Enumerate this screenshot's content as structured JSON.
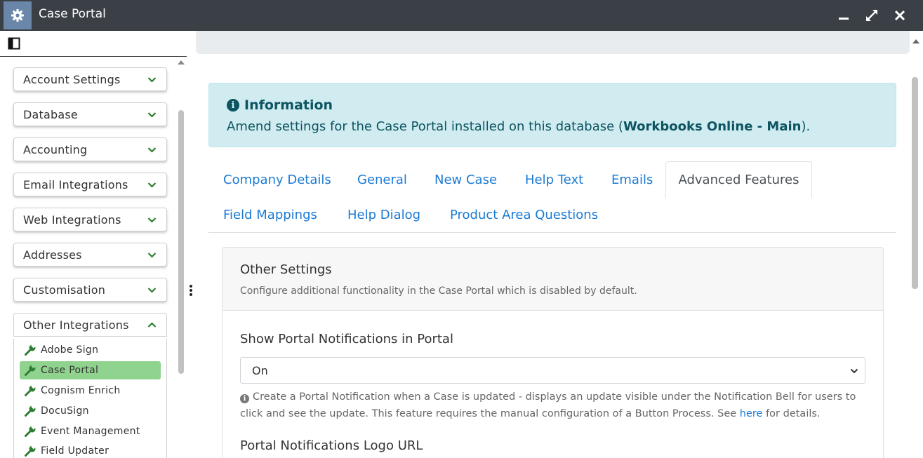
{
  "window": {
    "title": "Case Portal"
  },
  "sidebar": {
    "menus": [
      {
        "label": "Account Settings",
        "expanded": false
      },
      {
        "label": "Database",
        "expanded": false
      },
      {
        "label": "Accounting",
        "expanded": false
      },
      {
        "label": "Email Integrations",
        "expanded": false
      },
      {
        "label": "Web Integrations",
        "expanded": false
      },
      {
        "label": "Addresses",
        "expanded": false
      },
      {
        "label": "Customisation",
        "expanded": false
      },
      {
        "label": "Other Integrations",
        "expanded": true
      }
    ],
    "sub_items": [
      {
        "label": "Adobe Sign",
        "active": false
      },
      {
        "label": "Case Portal",
        "active": true
      },
      {
        "label": "Cognism Enrich",
        "active": false
      },
      {
        "label": "DocuSign",
        "active": false
      },
      {
        "label": "Event Management",
        "active": false
      },
      {
        "label": "Field Updater",
        "active": false
      }
    ]
  },
  "info": {
    "title": "Information",
    "text_before": "Amend settings for the Case Portal installed on this database (",
    "text_bold": "Workbooks Online - Main",
    "text_after": ")."
  },
  "tabs": {
    "row1": [
      "Company Details",
      "General",
      "New Case",
      "Help Text",
      "Emails"
    ],
    "active": "Advanced Features",
    "row2": [
      "Field Mappings",
      "Help Dialog",
      "Product Area Questions"
    ]
  },
  "card": {
    "title": "Other Settings",
    "subtitle": "Configure additional functionality in the Case Portal which is disabled by default.",
    "field1_label": "Show Portal Notifications in Portal",
    "field1_value": "On",
    "help_before": "Create a Portal Notification when a Case is updated - displays an update visible under the Notification Bell for users to click and see the update. This feature requires the manual configuration of a Button Process. See ",
    "help_link": "here",
    "help_after": " for details.",
    "field2_label": "Portal Notifications Logo URL"
  },
  "colors": {
    "titlebar": "#3b3f46",
    "info_bg": "#d1ecf1",
    "info_text": "#0c5460",
    "link": "#1a7ad4",
    "active_item": "#8fd38f",
    "icon_green": "#2e7d32"
  }
}
